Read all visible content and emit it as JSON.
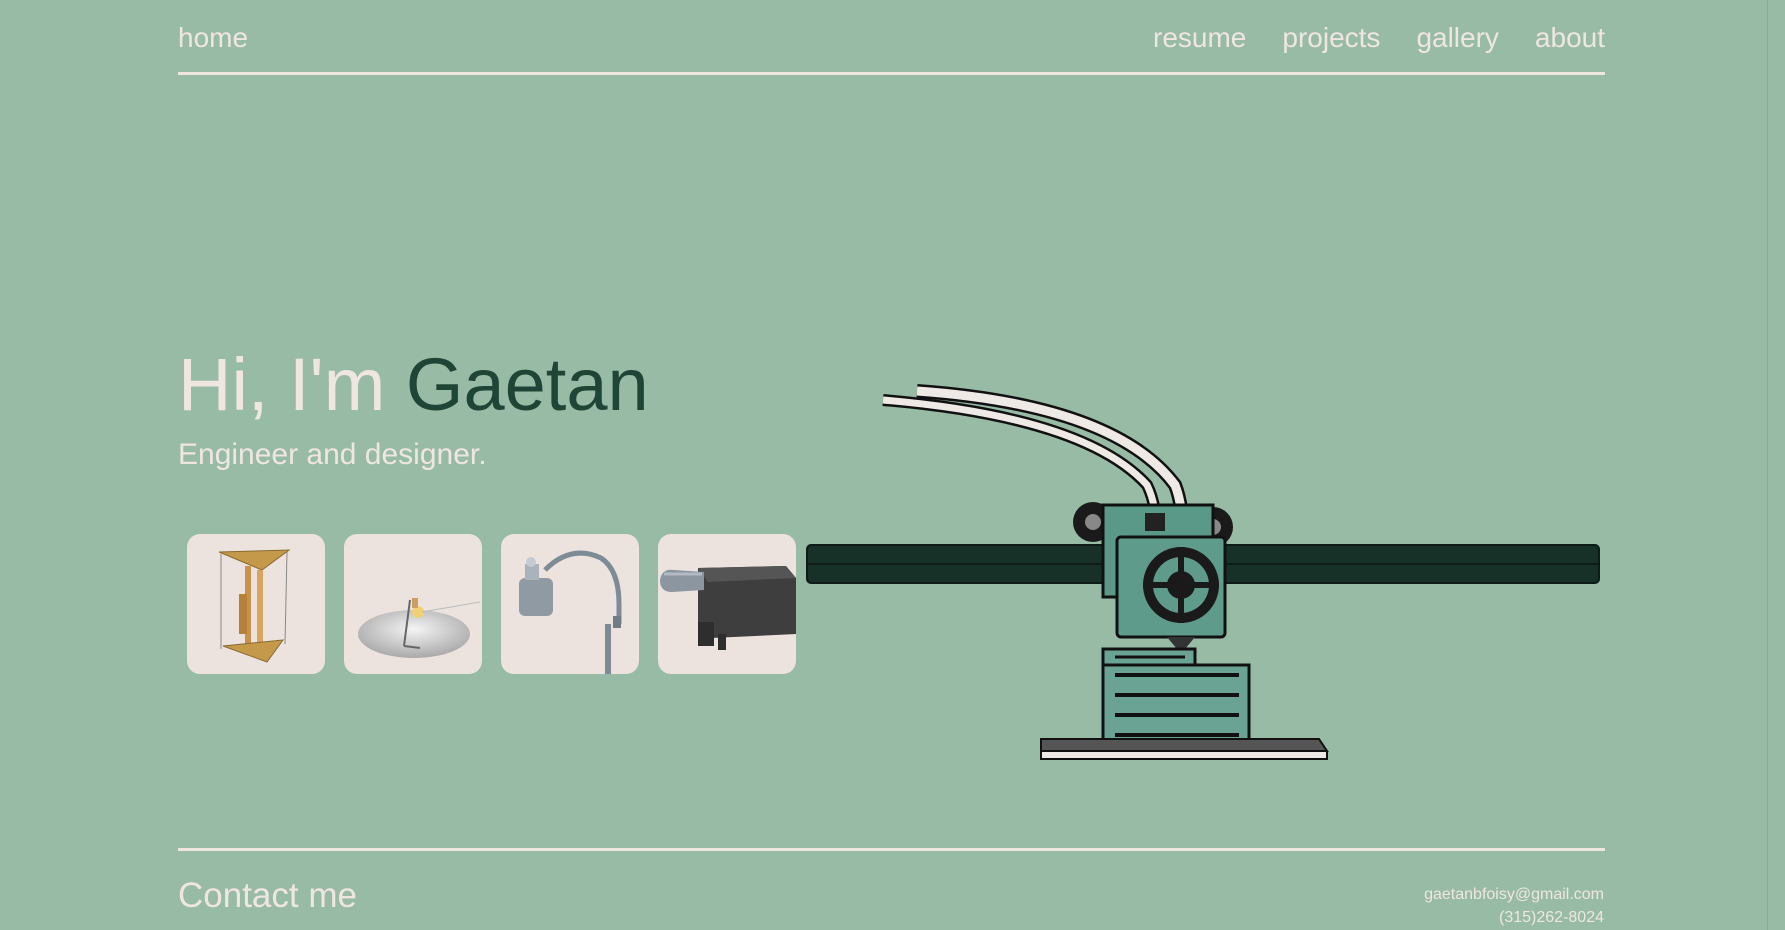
{
  "nav": {
    "home": "home",
    "links": [
      "resume",
      "projects",
      "gallery",
      "about"
    ]
  },
  "hero": {
    "greeting": "Hi, I'm ",
    "name": "Gaetan",
    "subtitle": "Engineer and designer."
  },
  "thumbnails": [
    {
      "icon": "tower-model-icon"
    },
    {
      "icon": "lamp-dish-icon"
    },
    {
      "icon": "desk-lamp-icon"
    },
    {
      "icon": "clip-part-icon"
    }
  ],
  "illustration": {
    "icon": "3d-printer-extruder-icon"
  },
  "contact": {
    "title": "Contact me",
    "email": "gaetanbfoisy@gmail.com",
    "phone": "(315)262-8024"
  },
  "colors": {
    "background": "#98bba6",
    "text": "#efe6e1",
    "accent_name": "#1f4536",
    "thumb_bg": "#ece3de"
  }
}
